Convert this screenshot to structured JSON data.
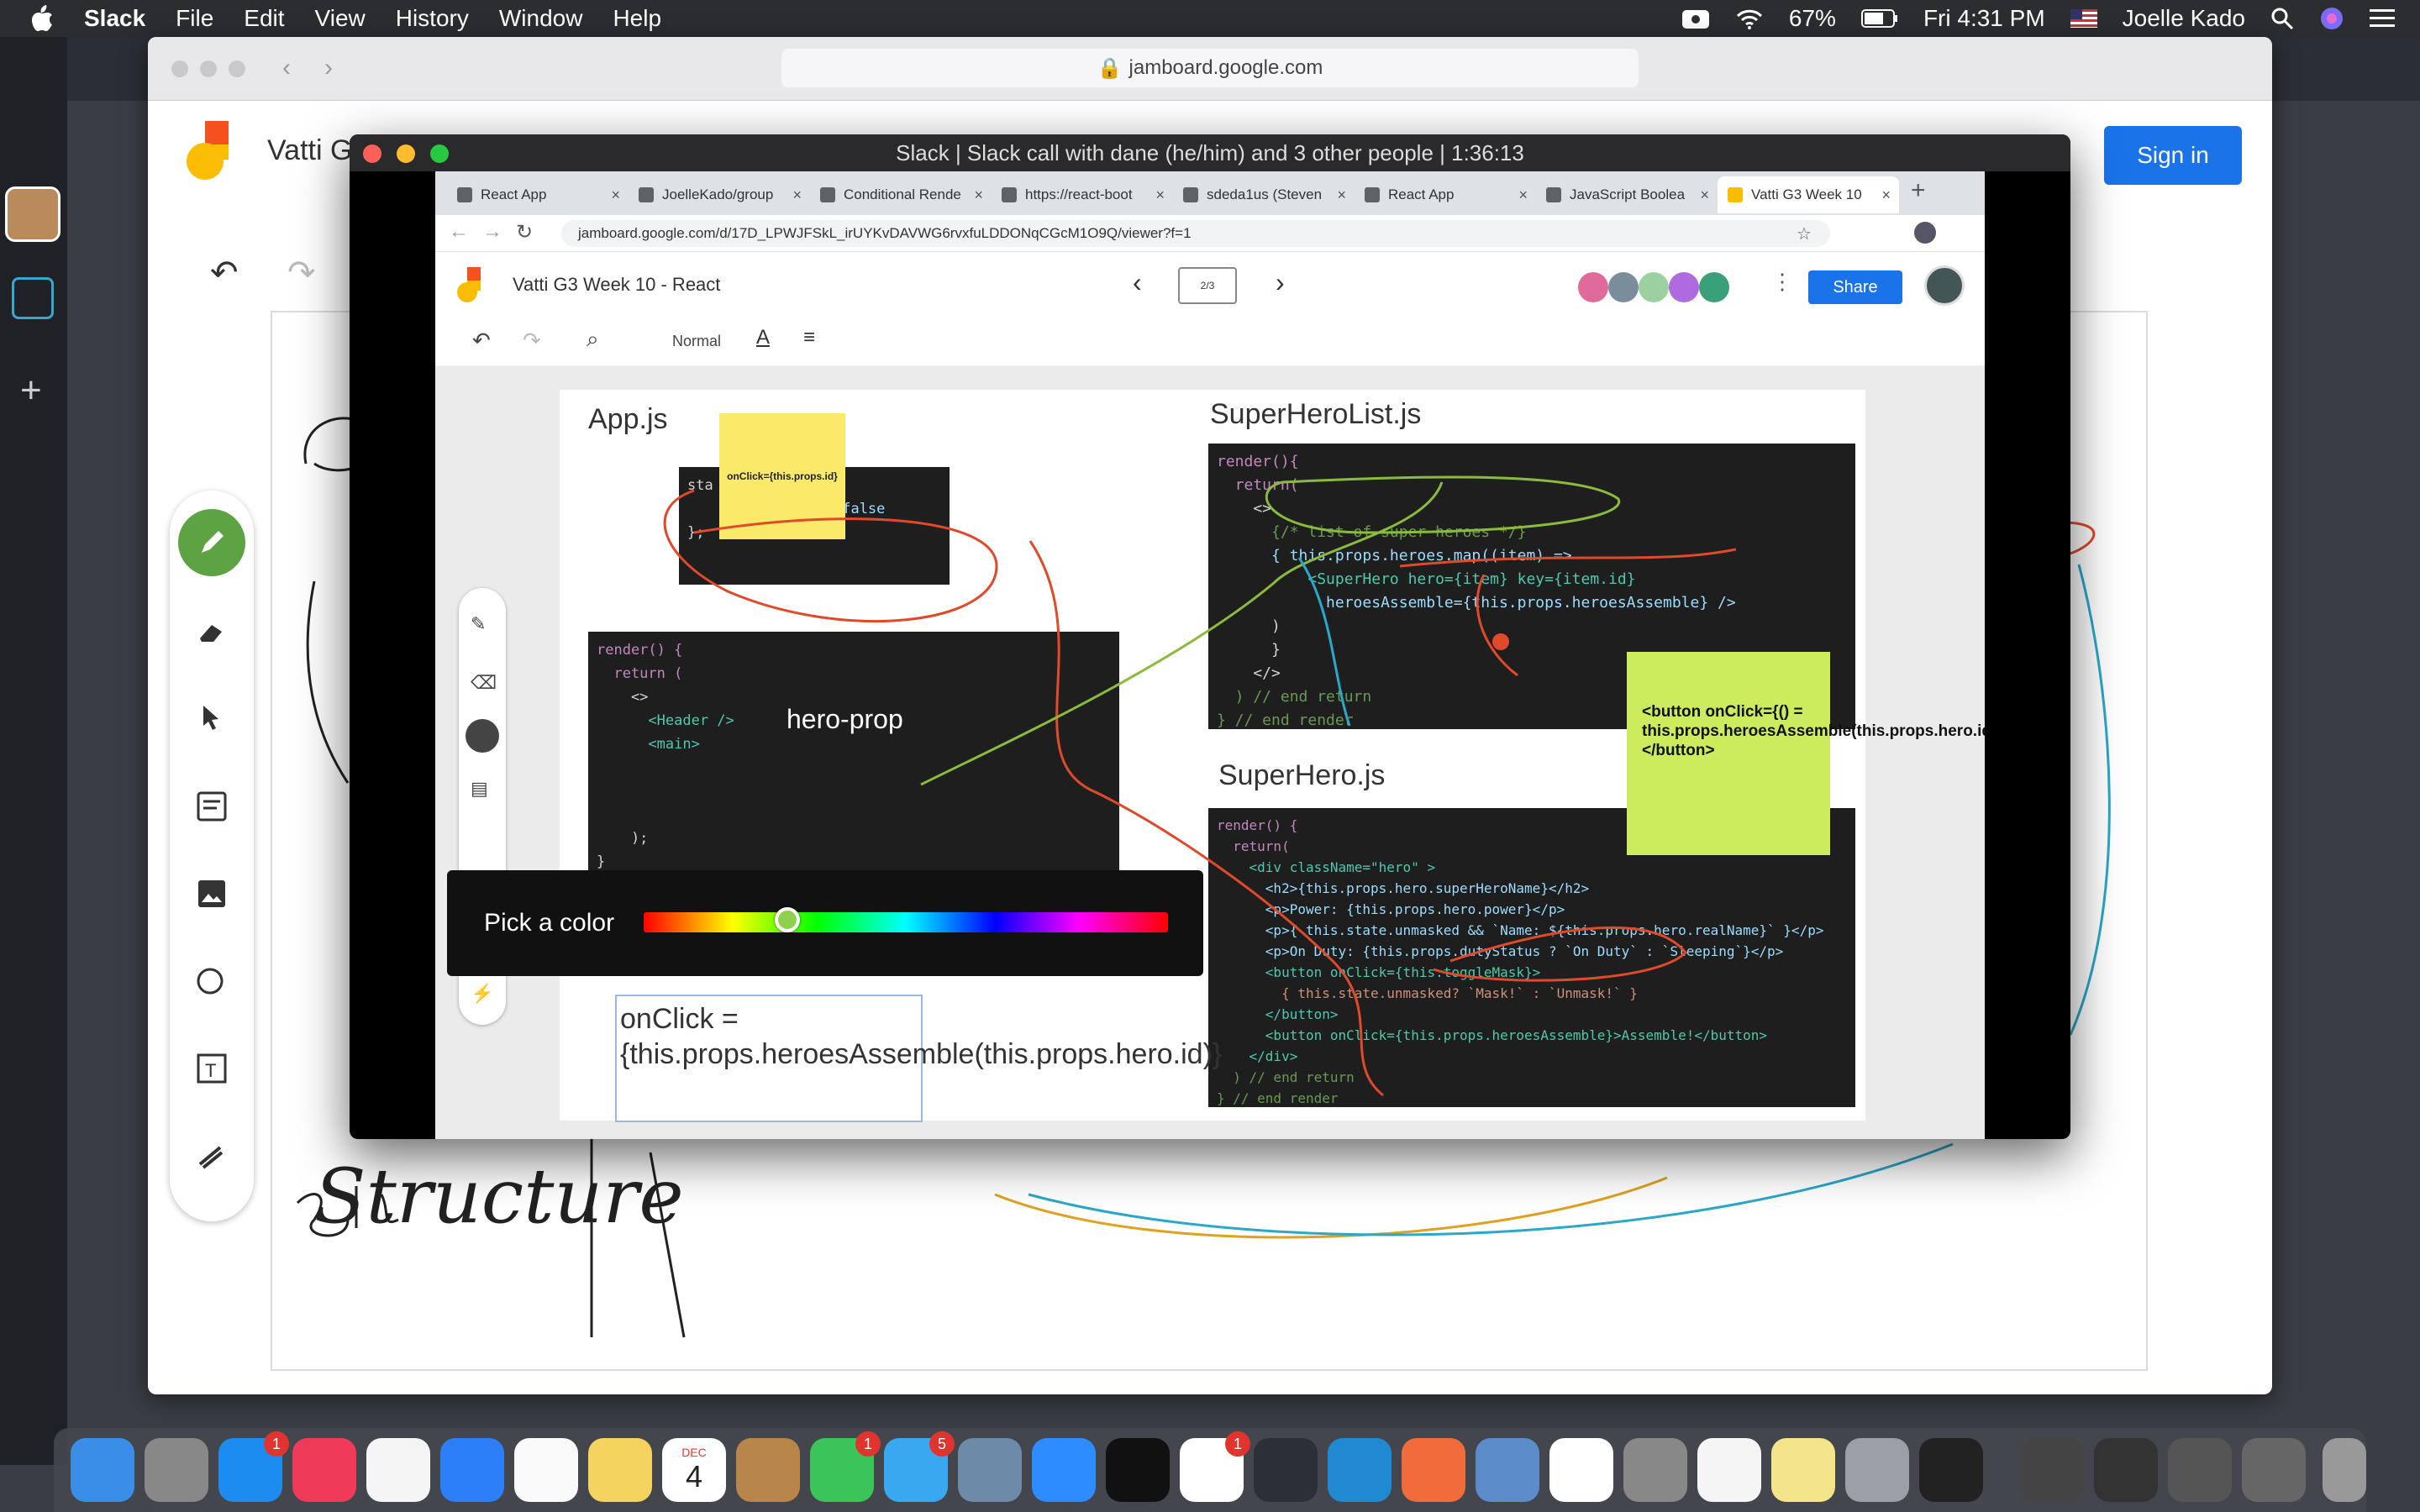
{
  "menubar": {
    "app_name": "Slack",
    "items": [
      "File",
      "Edit",
      "View",
      "History",
      "Window",
      "Help"
    ],
    "battery": "67%",
    "clock": "Fri 4:31 PM",
    "user": "Joelle Kado"
  },
  "safari": {
    "url": "jamboard.google.com"
  },
  "jamboard_bg": {
    "title": "Vatti G",
    "sign_in_label": "Sign in",
    "board_handwriting": "Structure"
  },
  "call_window": {
    "title": "Slack | Slack call with dane (he/him) and 3 other people | 1:36:13"
  },
  "shared_browser": {
    "tabs": [
      {
        "label": "React App"
      },
      {
        "label": "JoelleKado/group"
      },
      {
        "label": "Conditional Rende"
      },
      {
        "label": "https://react-boot"
      },
      {
        "label": "sdeda1us (Steven"
      },
      {
        "label": "React App"
      },
      {
        "label": "JavaScript Boolea"
      },
      {
        "label": "Vatti G3 Week 10"
      }
    ],
    "url": "jamboard.google.com/d/17D_LPWJFSkL_irUYKvDAVWG6rvxfuLDDONqCGcM1O9Q/viewer?f=1",
    "jam_title": "Vatti G3 Week 10 - React",
    "page_indicator": "2/3",
    "share_label": "Share",
    "font_style": "Normal"
  },
  "frame": {
    "app_heading": "App.js",
    "superherolist_heading": "SuperHeroList.js",
    "superhero_heading": "SuperHero.js",
    "hero_prop_label": "hero-prop",
    "sticky_yellow": "onClick={this.props.id}",
    "sticky_green": "<button onClick={() = this.props.heroesAssemble(this.props.hero.id)}>Assemble!</button>",
    "color_picker_label": "Pick a color",
    "color_value": "#8fd14f",
    "textbox": "onClick = {this.props.heroesAssemble(this.props.hero.id)}",
    "code_app_state": [
      "sta",
      "    areAssembled: false",
      "};"
    ],
    "code_app_render": [
      "render() {",
      "  return (",
      "    <>",
      "      <Header />",
      "      <main>"
    ],
    "code_app_render_end": [
      "    );",
      "}"
    ],
    "code_list": [
      "render(){",
      "  return(",
      "    <>",
      "      {/* list of super heroes */}",
      "      { this.props.heroes.map((item) =>",
      "          <SuperHero hero={item} key={item.id}",
      "            heroesAssemble={this.props.heroesAssemble} />",
      "      )",
      "      }",
      "    </>",
      "  ) // end return",
      "} // end render"
    ],
    "code_hero": [
      "render() {",
      "  return(",
      "    <div className=\"hero\" >",
      "      <h2>{this.props.hero.superHeroName}</h2>",
      "      <p>Power: {this.props.hero.power}</p>",
      "      <p>{ this.state.unmasked && `Name: ${this.props.hero.realName}` }</p>",
      "      <p>On Duty: {this.props.dutyStatus ? `On Duty` : `Sleeping`}</p>",
      "      <button onClick={this.toggleMask}>",
      "        { this.state.unmasked? `Mask!` : `Unmask!` }",
      "      </button>",
      "      <button onClick={this.props.heroesAssemble}>Assemble!</button>",
      "    </div>",
      "  ) // end return",
      "} // end render"
    ]
  },
  "dock": {
    "calendar_month": "DEC",
    "calendar_day": "4",
    "badges": {
      "appstore": "1",
      "facetime": "1",
      "messages": "5",
      "slack": "1"
    }
  }
}
